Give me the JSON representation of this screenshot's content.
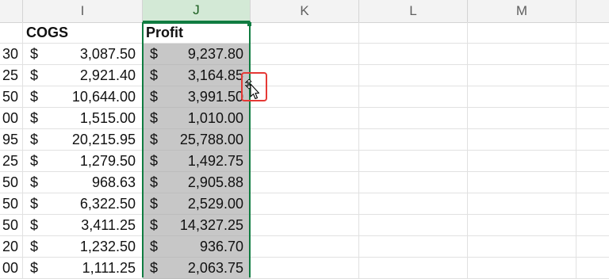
{
  "columns": {
    "partial": "",
    "i": "I",
    "j": "J",
    "k": "K",
    "l": "L",
    "m": "M"
  },
  "headers": {
    "cogs": "COGS",
    "profit": "Profit"
  },
  "rows": [
    {
      "prev": "30",
      "cogs_sym": "$",
      "cogs": "3,087.50",
      "profit_sym": "$",
      "profit": "9,237.80"
    },
    {
      "prev": "25",
      "cogs_sym": "$",
      "cogs": "2,921.40",
      "profit_sym": "$",
      "profit": "3,164.85"
    },
    {
      "prev": "50",
      "cogs_sym": "$",
      "cogs": "10,644.00",
      "profit_sym": "$",
      "profit": "3,991.50"
    },
    {
      "prev": "00",
      "cogs_sym": "$",
      "cogs": "1,515.00",
      "profit_sym": "$",
      "profit": "1,010.00"
    },
    {
      "prev": "95",
      "cogs_sym": "$",
      "cogs": "20,215.95",
      "profit_sym": "$",
      "profit": "25,788.00"
    },
    {
      "prev": "25",
      "cogs_sym": "$",
      "cogs": "1,279.50",
      "profit_sym": "$",
      "profit": "1,492.75"
    },
    {
      "prev": "50",
      "cogs_sym": "$",
      "cogs": "968.63",
      "profit_sym": "$",
      "profit": "2,905.88"
    },
    {
      "prev": "50",
      "cogs_sym": "$",
      "cogs": "6,322.50",
      "profit_sym": "$",
      "profit": "2,529.00"
    },
    {
      "prev": "50",
      "cogs_sym": "$",
      "cogs": "3,411.25",
      "profit_sym": "$",
      "profit": "14,327.25"
    },
    {
      "prev": "20",
      "cogs_sym": "$",
      "cogs": "1,232.50",
      "profit_sym": "$",
      "profit": "936.70"
    },
    {
      "prev": "00",
      "cogs_sym": "$",
      "cogs": "1,111.25",
      "profit_sym": "$",
      "profit": "2,063.75"
    }
  ],
  "colors": {
    "selection": "#107c41",
    "selected_header_bg": "#d3e9d6",
    "selected_cells_bg": "#c7c7c7",
    "highlight": "#e53935"
  },
  "cursor": "move-cursor-icon"
}
